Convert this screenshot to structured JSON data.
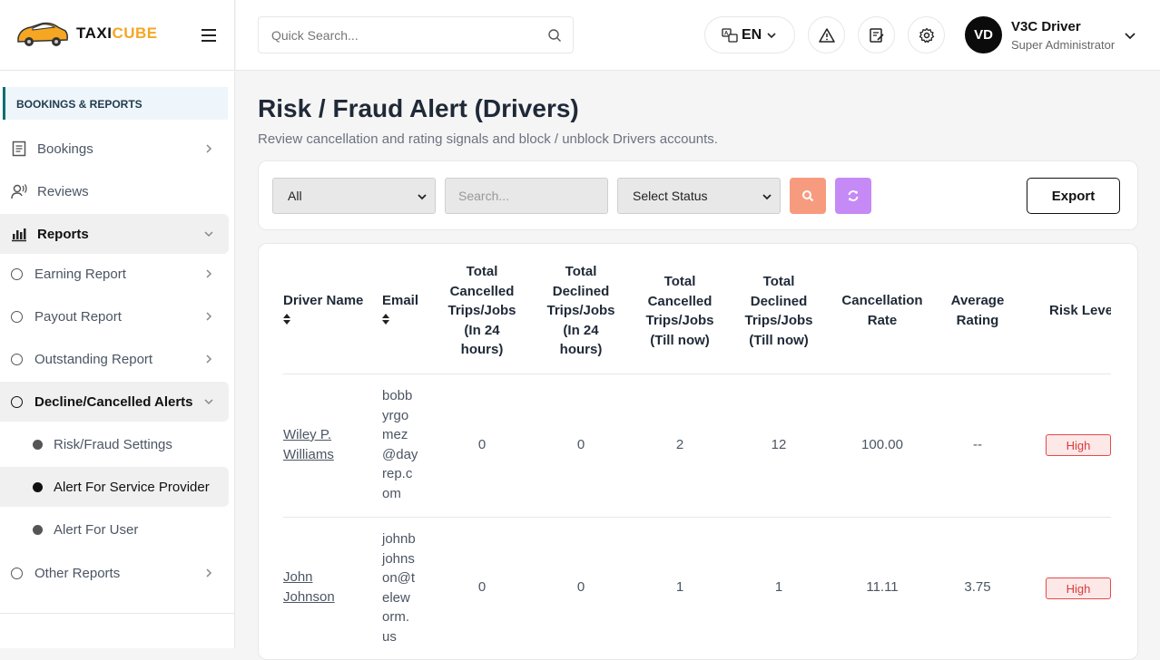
{
  "brand": {
    "part1": "TAXI",
    "part2": "CUBE"
  },
  "sidebar": {
    "section_header": "BOOKINGS & REPORTS",
    "items": [
      {
        "label": "Bookings"
      },
      {
        "label": "Reviews"
      },
      {
        "label": "Reports"
      },
      {
        "label": "Earning Report"
      },
      {
        "label": "Payout Report"
      },
      {
        "label": "Outstanding Report"
      },
      {
        "label": "Decline/Cancelled Alerts"
      },
      {
        "label": "Risk/Fraud Settings"
      },
      {
        "label": "Alert For Service Provider"
      },
      {
        "label": "Alert For User"
      },
      {
        "label": "Other Reports"
      }
    ]
  },
  "topbar": {
    "search_placeholder": "Quick Search...",
    "language": "EN",
    "user": {
      "initials": "VD",
      "name": "V3C Driver",
      "role": "Super Administrator"
    }
  },
  "page": {
    "title": "Risk / Fraud Alert (Drivers)",
    "subtitle": "Review cancellation and rating signals and block / unblock Drivers accounts."
  },
  "filters": {
    "type_value": "All",
    "search_placeholder": "Search...",
    "status_value": "Select Status",
    "export_label": "Export"
  },
  "table": {
    "headers": {
      "driver_name": "Driver Name",
      "email": "Email",
      "h3": [
        "Total",
        "Cancelled",
        "Trips/Jobs",
        "(In 24",
        "hours)"
      ],
      "h4": [
        "Total",
        "Declined",
        "Trips/Jobs",
        "(In 24",
        "hours)"
      ],
      "h5": [
        "Total",
        "Cancelled",
        "Trips/Jobs",
        "(Till now)"
      ],
      "h6": [
        "Total",
        "Declined",
        "Trips/Jobs",
        "(Till now)"
      ],
      "h7": [
        "Cancellation",
        "Rate"
      ],
      "h8": [
        "Average",
        "Rating"
      ],
      "risk": "Risk Level"
    },
    "rows": [
      {
        "name": [
          "Wiley P.",
          "Williams"
        ],
        "email": [
          "bobb",
          "yrgo",
          "mez",
          "@day",
          "rep.c",
          "om"
        ],
        "cancel24": "0",
        "decline24": "0",
        "cancelAll": "2",
        "declineAll": "12",
        "rate": "100.00",
        "rating": "--",
        "risk": "High"
      },
      {
        "name": [
          "John",
          "Johnson"
        ],
        "email": [
          "johnb",
          "johns",
          "on@t",
          "elew",
          "orm.",
          "us"
        ],
        "cancel24": "0",
        "decline24": "0",
        "cancelAll": "1",
        "declineAll": "1",
        "rate": "11.11",
        "rating": "3.75",
        "risk": "High"
      }
    ]
  },
  "colors": {
    "search_btn": "#f79b7f",
    "reset_btn": "#c58af5",
    "accent": "#0e6e73",
    "risk_high": "#d93b3b"
  }
}
